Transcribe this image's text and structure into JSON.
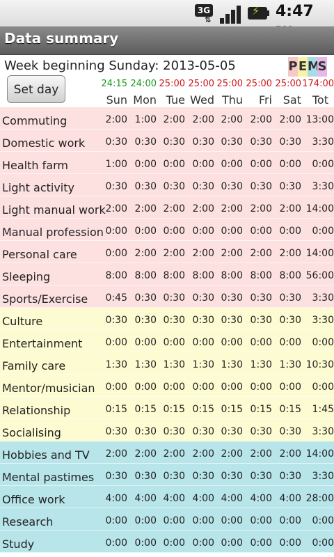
{
  "statusbar": {
    "network_label": "3G",
    "network_arrows": "⇅",
    "time": "4:47",
    "ampm": "PM",
    "icons": [
      "3g-icon",
      "signal-icon",
      "battery-charging-icon"
    ]
  },
  "titlebar": {
    "title": "Data summary"
  },
  "header": {
    "week_label": "Week beginning Sunday: 2013-05-05",
    "set_day_button": "Set day",
    "pems": [
      {
        "letter": "P",
        "color": "#f8c8c8"
      },
      {
        "letter": "E",
        "color": "#f8f3a8"
      },
      {
        "letter": "M",
        "color": "#a8dde8"
      },
      {
        "letter": "S",
        "color": "#e8b8e6"
      }
    ],
    "totals": [
      {
        "text": "24:15",
        "color": "#1c9a1c"
      },
      {
        "text": "24:00",
        "color": "#1c9a1c"
      },
      {
        "text": "25:00",
        "color": "#d01818"
      },
      {
        "text": "25:00",
        "color": "#d01818"
      },
      {
        "text": "25:00",
        "color": "#d01818"
      },
      {
        "text": "25:00",
        "color": "#d01818"
      },
      {
        "text": "25:00",
        "color": "#d01818"
      },
      {
        "text": "174:00",
        "color": "#d01818"
      }
    ],
    "days": [
      "Sun",
      "Mon",
      "Tue",
      "Wed",
      "Thu",
      "Fri",
      "Sat",
      "Tot"
    ]
  },
  "rows": [
    {
      "group": "p",
      "label": "Commuting",
      "values": [
        "2:00",
        "1:00",
        "2:00",
        "2:00",
        "2:00",
        "2:00",
        "2:00",
        "13:00"
      ]
    },
    {
      "group": "p",
      "label": "Domestic work",
      "values": [
        "0:30",
        "0:30",
        "0:30",
        "0:30",
        "0:30",
        "0:30",
        "0:30",
        "3:30"
      ]
    },
    {
      "group": "p",
      "label": "Health farm",
      "values": [
        "1:00",
        "0:00",
        "0:00",
        "0:00",
        "0:00",
        "0:00",
        "0:00",
        "0:00"
      ]
    },
    {
      "group": "p",
      "label": "Light activity",
      "values": [
        "0:30",
        "0:30",
        "0:30",
        "0:30",
        "0:30",
        "0:30",
        "0:30",
        "3:30"
      ]
    },
    {
      "group": "p",
      "label": "Light manual work",
      "values": [
        "2:00",
        "2:00",
        "2:00",
        "2:00",
        "2:00",
        "2:00",
        "2:00",
        "14:00"
      ]
    },
    {
      "group": "p",
      "label": "Manual profession",
      "values": [
        "0:00",
        "0:00",
        "0:00",
        "0:00",
        "0:00",
        "0:00",
        "0:00",
        "0:00"
      ]
    },
    {
      "group": "p",
      "label": "Personal care",
      "values": [
        "0:00",
        "2:00",
        "2:00",
        "2:00",
        "2:00",
        "2:00",
        "2:00",
        "14:00"
      ]
    },
    {
      "group": "p",
      "label": "Sleeping",
      "values": [
        "8:00",
        "8:00",
        "8:00",
        "8:00",
        "8:00",
        "8:00",
        "8:00",
        "56:00"
      ]
    },
    {
      "group": "p",
      "label": "Sports/Exercise",
      "values": [
        "0:45",
        "0:30",
        "0:30",
        "0:30",
        "0:30",
        "0:30",
        "0:30",
        "3:30"
      ]
    },
    {
      "group": "e",
      "label": "Culture",
      "values": [
        "0:30",
        "0:30",
        "0:30",
        "0:30",
        "0:30",
        "0:30",
        "0:30",
        "3:30"
      ]
    },
    {
      "group": "e",
      "label": "Entertainment",
      "values": [
        "0:00",
        "0:00",
        "0:00",
        "0:00",
        "0:00",
        "0:00",
        "0:00",
        "0:00"
      ]
    },
    {
      "group": "e",
      "label": "Family care",
      "values": [
        "1:30",
        "1:30",
        "1:30",
        "1:30",
        "1:30",
        "1:30",
        "1:30",
        "10:30"
      ]
    },
    {
      "group": "e",
      "label": "Mentor/musician",
      "values": [
        "0:00",
        "0:00",
        "0:00",
        "0:00",
        "0:00",
        "0:00",
        "0:00",
        "0:00"
      ]
    },
    {
      "group": "e",
      "label": "Relationship",
      "values": [
        "0:15",
        "0:15",
        "0:15",
        "0:15",
        "0:15",
        "0:15",
        "0:15",
        "1:45"
      ]
    },
    {
      "group": "e",
      "label": "Socialising",
      "values": [
        "0:30",
        "0:30",
        "0:30",
        "0:30",
        "0:30",
        "0:30",
        "0:30",
        "3:30"
      ]
    },
    {
      "group": "m",
      "label": "Hobbies and TV",
      "values": [
        "2:00",
        "2:00",
        "2:00",
        "2:00",
        "2:00",
        "2:00",
        "2:00",
        "14:00"
      ]
    },
    {
      "group": "m",
      "label": "Mental pastimes",
      "values": [
        "0:30",
        "0:30",
        "0:30",
        "0:30",
        "0:30",
        "0:30",
        "0:30",
        "3:30"
      ]
    },
    {
      "group": "m",
      "label": "Office work",
      "values": [
        "4:00",
        "4:00",
        "4:00",
        "4:00",
        "4:00",
        "4:00",
        "4:00",
        "28:00"
      ]
    },
    {
      "group": "m",
      "label": "Research",
      "values": [
        "0:00",
        "0:00",
        "0:00",
        "0:00",
        "0:00",
        "0:00",
        "0:00",
        "0:00"
      ]
    },
    {
      "group": "m",
      "label": "Study",
      "values": [
        "0:00",
        "0:00",
        "0:00",
        "0:00",
        "0:00",
        "0:00",
        "0:00",
        "0:00"
      ]
    }
  ]
}
